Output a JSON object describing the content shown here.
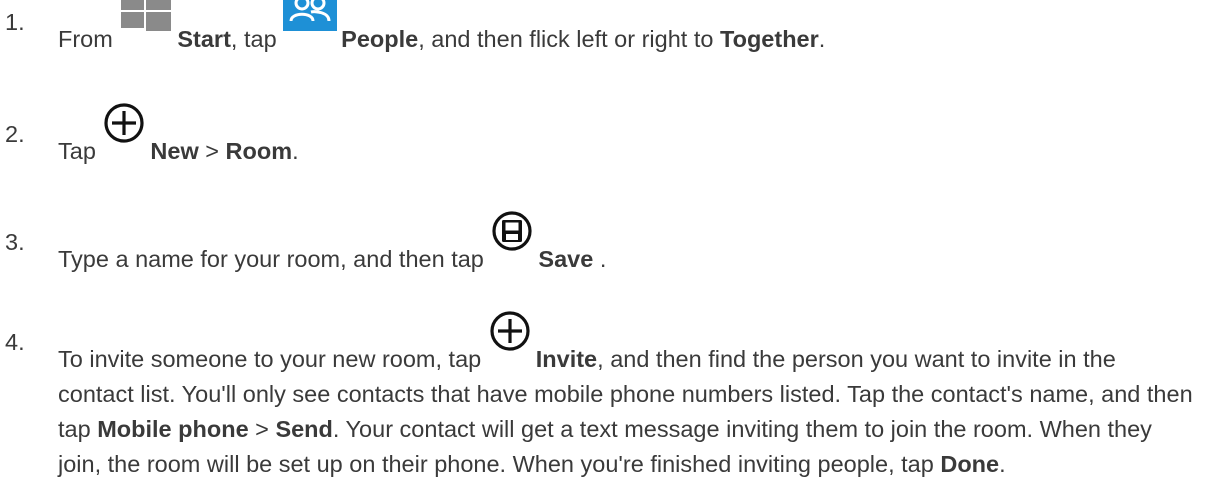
{
  "steps": [
    {
      "number": "1.",
      "parts": {
        "from": "From",
        "start": "Start",
        "tap": ", tap",
        "people": "People",
        "rest": ", and then flick left or right to",
        "together": "Together",
        "end": "."
      },
      "icons": [
        "windows-start-icon",
        "people-tile-icon"
      ]
    },
    {
      "number": "2.",
      "parts": {
        "tap": "Tap",
        "new": "New",
        "sep": ">",
        "room": "Room",
        "end": "."
      },
      "icons": [
        "plus-circle-icon"
      ]
    },
    {
      "number": "3.",
      "parts": {
        "text": "Type a name for your room, and then tap",
        "save": "Save",
        "end": "."
      },
      "icons": [
        "save-circle-icon"
      ]
    },
    {
      "number": "4.",
      "parts": {
        "text1": "To invite someone to your new room, tap",
        "invite": "Invite",
        "text2": ", and then find the person you want to invite in the contact list. You'll only see contacts that have mobile phone numbers listed. Tap the contact's name, and then tap",
        "mobile_phone": "Mobile phone",
        "sep": ">",
        "send": "Send",
        "text3": ". Your contact will get a text message inviting them to join the room. When they join, the room will be set up on their phone. When you're finished inviting people, tap",
        "done": "Done",
        "end": "."
      },
      "icons": [
        "plus-circle-icon"
      ]
    }
  ],
  "colors": {
    "text": "#3a3a3a",
    "windows_logo": "#8a8a8a",
    "people_tile": "#1e90d6"
  }
}
